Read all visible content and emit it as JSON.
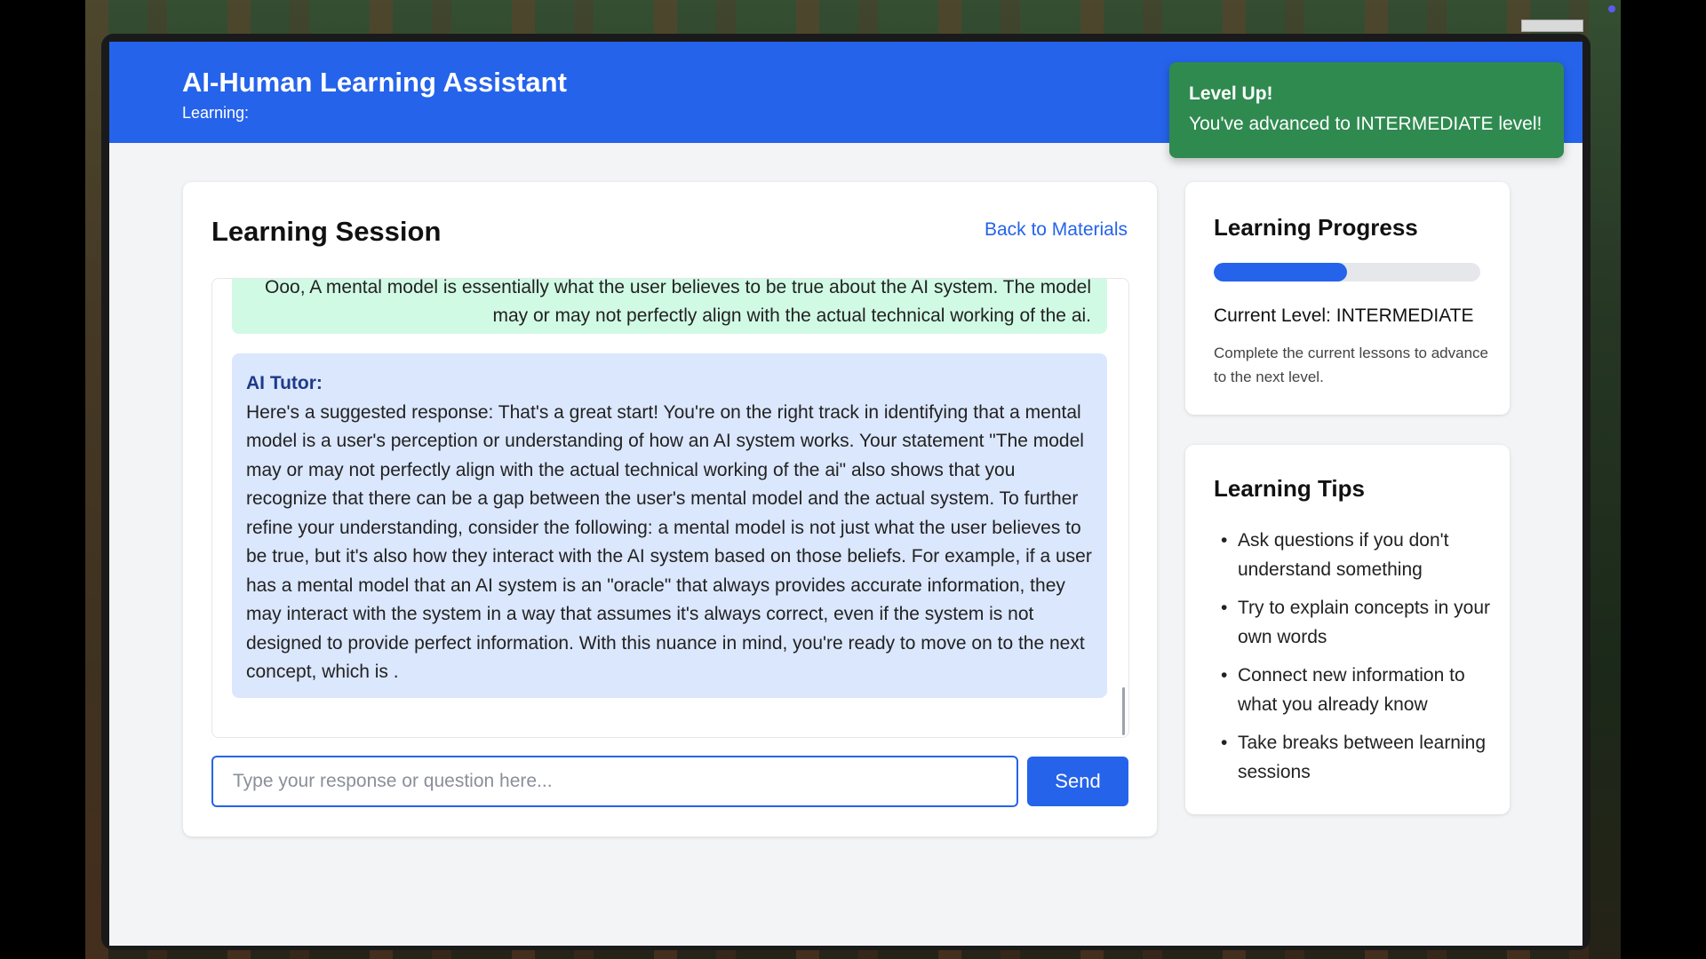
{
  "app": {
    "title": "AI-Human Learning Assistant",
    "subtitle": "Learning:"
  },
  "toast": {
    "title": "Level Up!",
    "message": "You've advanced to INTERMEDIATE level!"
  },
  "session": {
    "title": "Learning Session",
    "back_link": "Back to Materials",
    "messages": {
      "user_text": "Ooo, A mental model is essentially what the user believes to be true about the AI system. The model may or may not perfectly align with the actual technical working of the ai.",
      "ai_label": "AI Tutor:",
      "ai_text": "Here's a suggested response: That's a great start! You're on the right track in identifying that a mental model is a user's perception or understanding of how an AI system works. Your statement \"The model may or may not perfectly align with the actual technical working of the ai\" also shows that you recognize that there can be a gap between the user's mental model and the actual system. To further refine your understanding, consider the following: a mental model is not just what the user believes to be true, but it's also how they interact with the AI system based on those beliefs. For example, if a user has a mental model that an AI system is an \"oracle\" that always provides accurate information, they may interact with the system in a way that assumes it's always correct, even if the system is not designed to provide perfect information. With this nuance in mind, you're ready to move on to the next concept, which is ."
    },
    "input": {
      "placeholder": "Type your response or question here...",
      "value": ""
    },
    "send_label": "Send"
  },
  "progress": {
    "title": "Learning Progress",
    "fill_fraction": 0.5,
    "level_text": "Current Level: INTERMEDIATE",
    "hint": "Complete the current lessons to advance to the next level."
  },
  "tips": {
    "title": "Learning Tips",
    "bullet": "•",
    "items": [
      "Ask questions if you don't understand something",
      "Try to explain concepts in your own words",
      "Connect new information to what you already know",
      "Take breaks between learning sessions"
    ]
  },
  "colors": {
    "primary": "#2563eb",
    "toast_bg": "#2f8a50",
    "user_bubble": "#d1fae5",
    "ai_bubble": "#dbe7fd"
  }
}
